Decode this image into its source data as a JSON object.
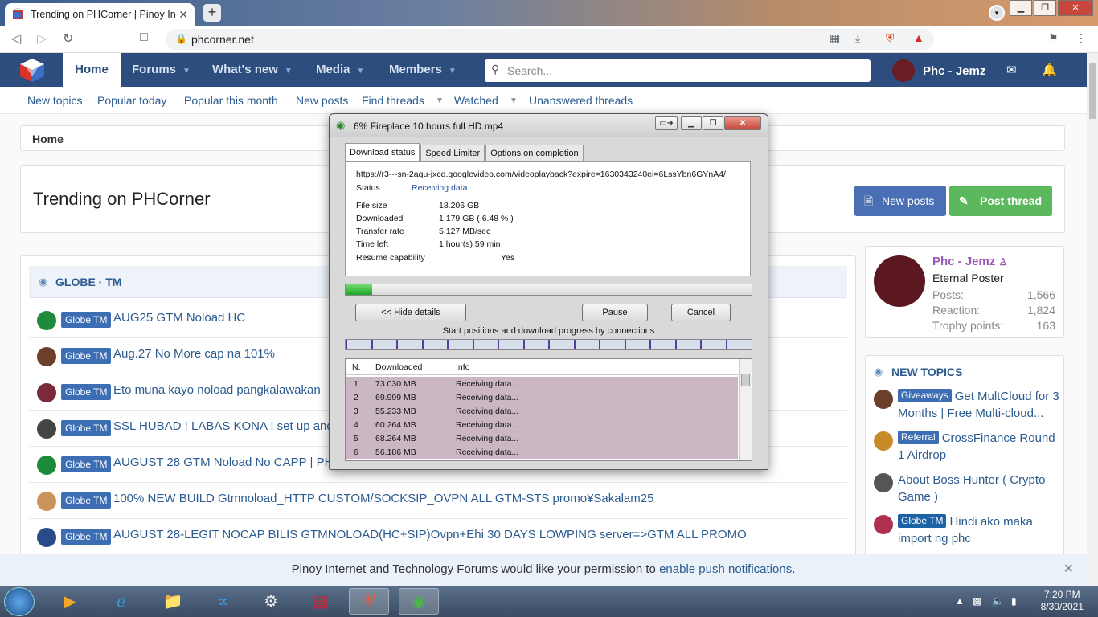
{
  "browser": {
    "tab_title": "Trending on PHCorner | Pinoy Int",
    "url": "phcorner.net"
  },
  "site": {
    "nav": [
      "Home",
      "Forums",
      "What's new",
      "Media",
      "Members"
    ],
    "search_placeholder": "Search...",
    "username": "Phc - Jemz",
    "subnav": [
      "New topics",
      "Popular today",
      "Popular this month",
      "New posts",
      "Find threads",
      "Watched",
      "Unanswered threads"
    ],
    "breadcrumb": "Home",
    "page_title": "Trending on PHCorner",
    "btn_new_posts": "New posts",
    "btn_post_thread": "Post thread",
    "section_title": "GLOBE · TM",
    "threads": [
      {
        "badge": "Globe TM",
        "title": "AUG25 GTM Noload HC",
        "color": "#1e8a3c"
      },
      {
        "badge": "Globe TM",
        "title": "Aug.27 No More cap na 101%",
        "color": "#6b3f2a"
      },
      {
        "badge": "Globe TM",
        "title": "Eto muna kayo noload pangkalawakan",
        "color": "#7a2a3a"
      },
      {
        "badge": "Globe TM",
        "title": "SSL HUBAD ! LABAS KONA ! set up and p",
        "color": "#444444"
      },
      {
        "badge": "Globe TM",
        "title": "AUGUST 28 GTM Noload No CAPP | PHC",
        "color": "#1e8a3c"
      },
      {
        "badge": "Globe TM",
        "title": "100% NEW BUILD Gtmnoload_HTTP CUSTOM/SOCKSIP_OVPN ALL GTM-STS promo¥Sakalam25",
        "color": "#c9935a"
      },
      {
        "badge": "Globe TM",
        "title": "AUGUST 28-LEGIT NOCAP BILIS GTMNOLOAD(HC+SIP)Ovpn+Ehi 30 DAYS LOWPING server=>GTM ALL PROMO",
        "color": "#2a4a8a"
      }
    ],
    "profile": {
      "name": "Phc - Jemz",
      "rank": "Eternal Poster",
      "stats": [
        {
          "label": "Posts:",
          "value": "1,566"
        },
        {
          "label": "Reaction:",
          "value": "1,824"
        },
        {
          "label": "Trophy points:",
          "value": "163"
        }
      ]
    },
    "new_topics_title": "NEW TOPICS",
    "new_topics": [
      {
        "badge": "Giveaways",
        "title": "Get MultCloud for 3 Months | Free Multi-cloud...",
        "color": "#6b3f2a"
      },
      {
        "badge": "Referral",
        "title": "CrossFinance Round 1 Airdrop",
        "color": "#c98a2a"
      },
      {
        "badge": "",
        "title": "About Boss Hunter ( Crypto Game )",
        "color": "#555555"
      },
      {
        "badge": "Globe TM",
        "title": "Hindi ako maka import ng phc",
        "color": "#b03050"
      }
    ],
    "notification": {
      "text": "Pinoy Internet and Technology Forums would like your permission to ",
      "link": "enable push notifications",
      "end": "."
    }
  },
  "download_dialog": {
    "title": "6% Fireplace 10 hours full HD.mp4",
    "tabs": [
      "Download status",
      "Speed Limiter",
      "Options on completion"
    ],
    "url": "https://r3---sn-2aqu-jxcd.googlevideo.com/videoplayback?expire=1630343240ei=6LssYbn6GYnA4/",
    "status_label": "Status",
    "status_value": "Receiving data...",
    "fields": [
      {
        "label": "File size",
        "value": "18.206  GB"
      },
      {
        "label": "Downloaded",
        "value": "1.179  GB  ( 6.48 % )"
      },
      {
        "label": "Transfer rate",
        "value": "5.127  MB/sec"
      },
      {
        "label": "Time left",
        "value": "1 hour(s) 59 min"
      }
    ],
    "resume_label": "Resume capability",
    "resume_value": "Yes",
    "progress_fraction": 0.0648,
    "btn_hide": "<< Hide details",
    "btn_pause": "Pause",
    "btn_cancel": "Cancel",
    "connections_caption": "Start positions and download progress by connections",
    "list_headers": [
      "N.",
      "Downloaded",
      "Info"
    ],
    "connections": [
      {
        "n": "1",
        "downloaded": "73.030  MB",
        "info": "Receiving data..."
      },
      {
        "n": "2",
        "downloaded": "69.999  MB",
        "info": "Receiving data..."
      },
      {
        "n": "3",
        "downloaded": "55.233  MB",
        "info": "Receiving data..."
      },
      {
        "n": "4",
        "downloaded": "60.264  MB",
        "info": "Receiving data..."
      },
      {
        "n": "5",
        "downloaded": "68.264  MB",
        "info": "Receiving data..."
      },
      {
        "n": "6",
        "downloaded": "56.186  MB",
        "info": "Receiving data..."
      }
    ]
  },
  "taskbar": {
    "time": "7:20 PM",
    "date": "8/30/2021"
  }
}
